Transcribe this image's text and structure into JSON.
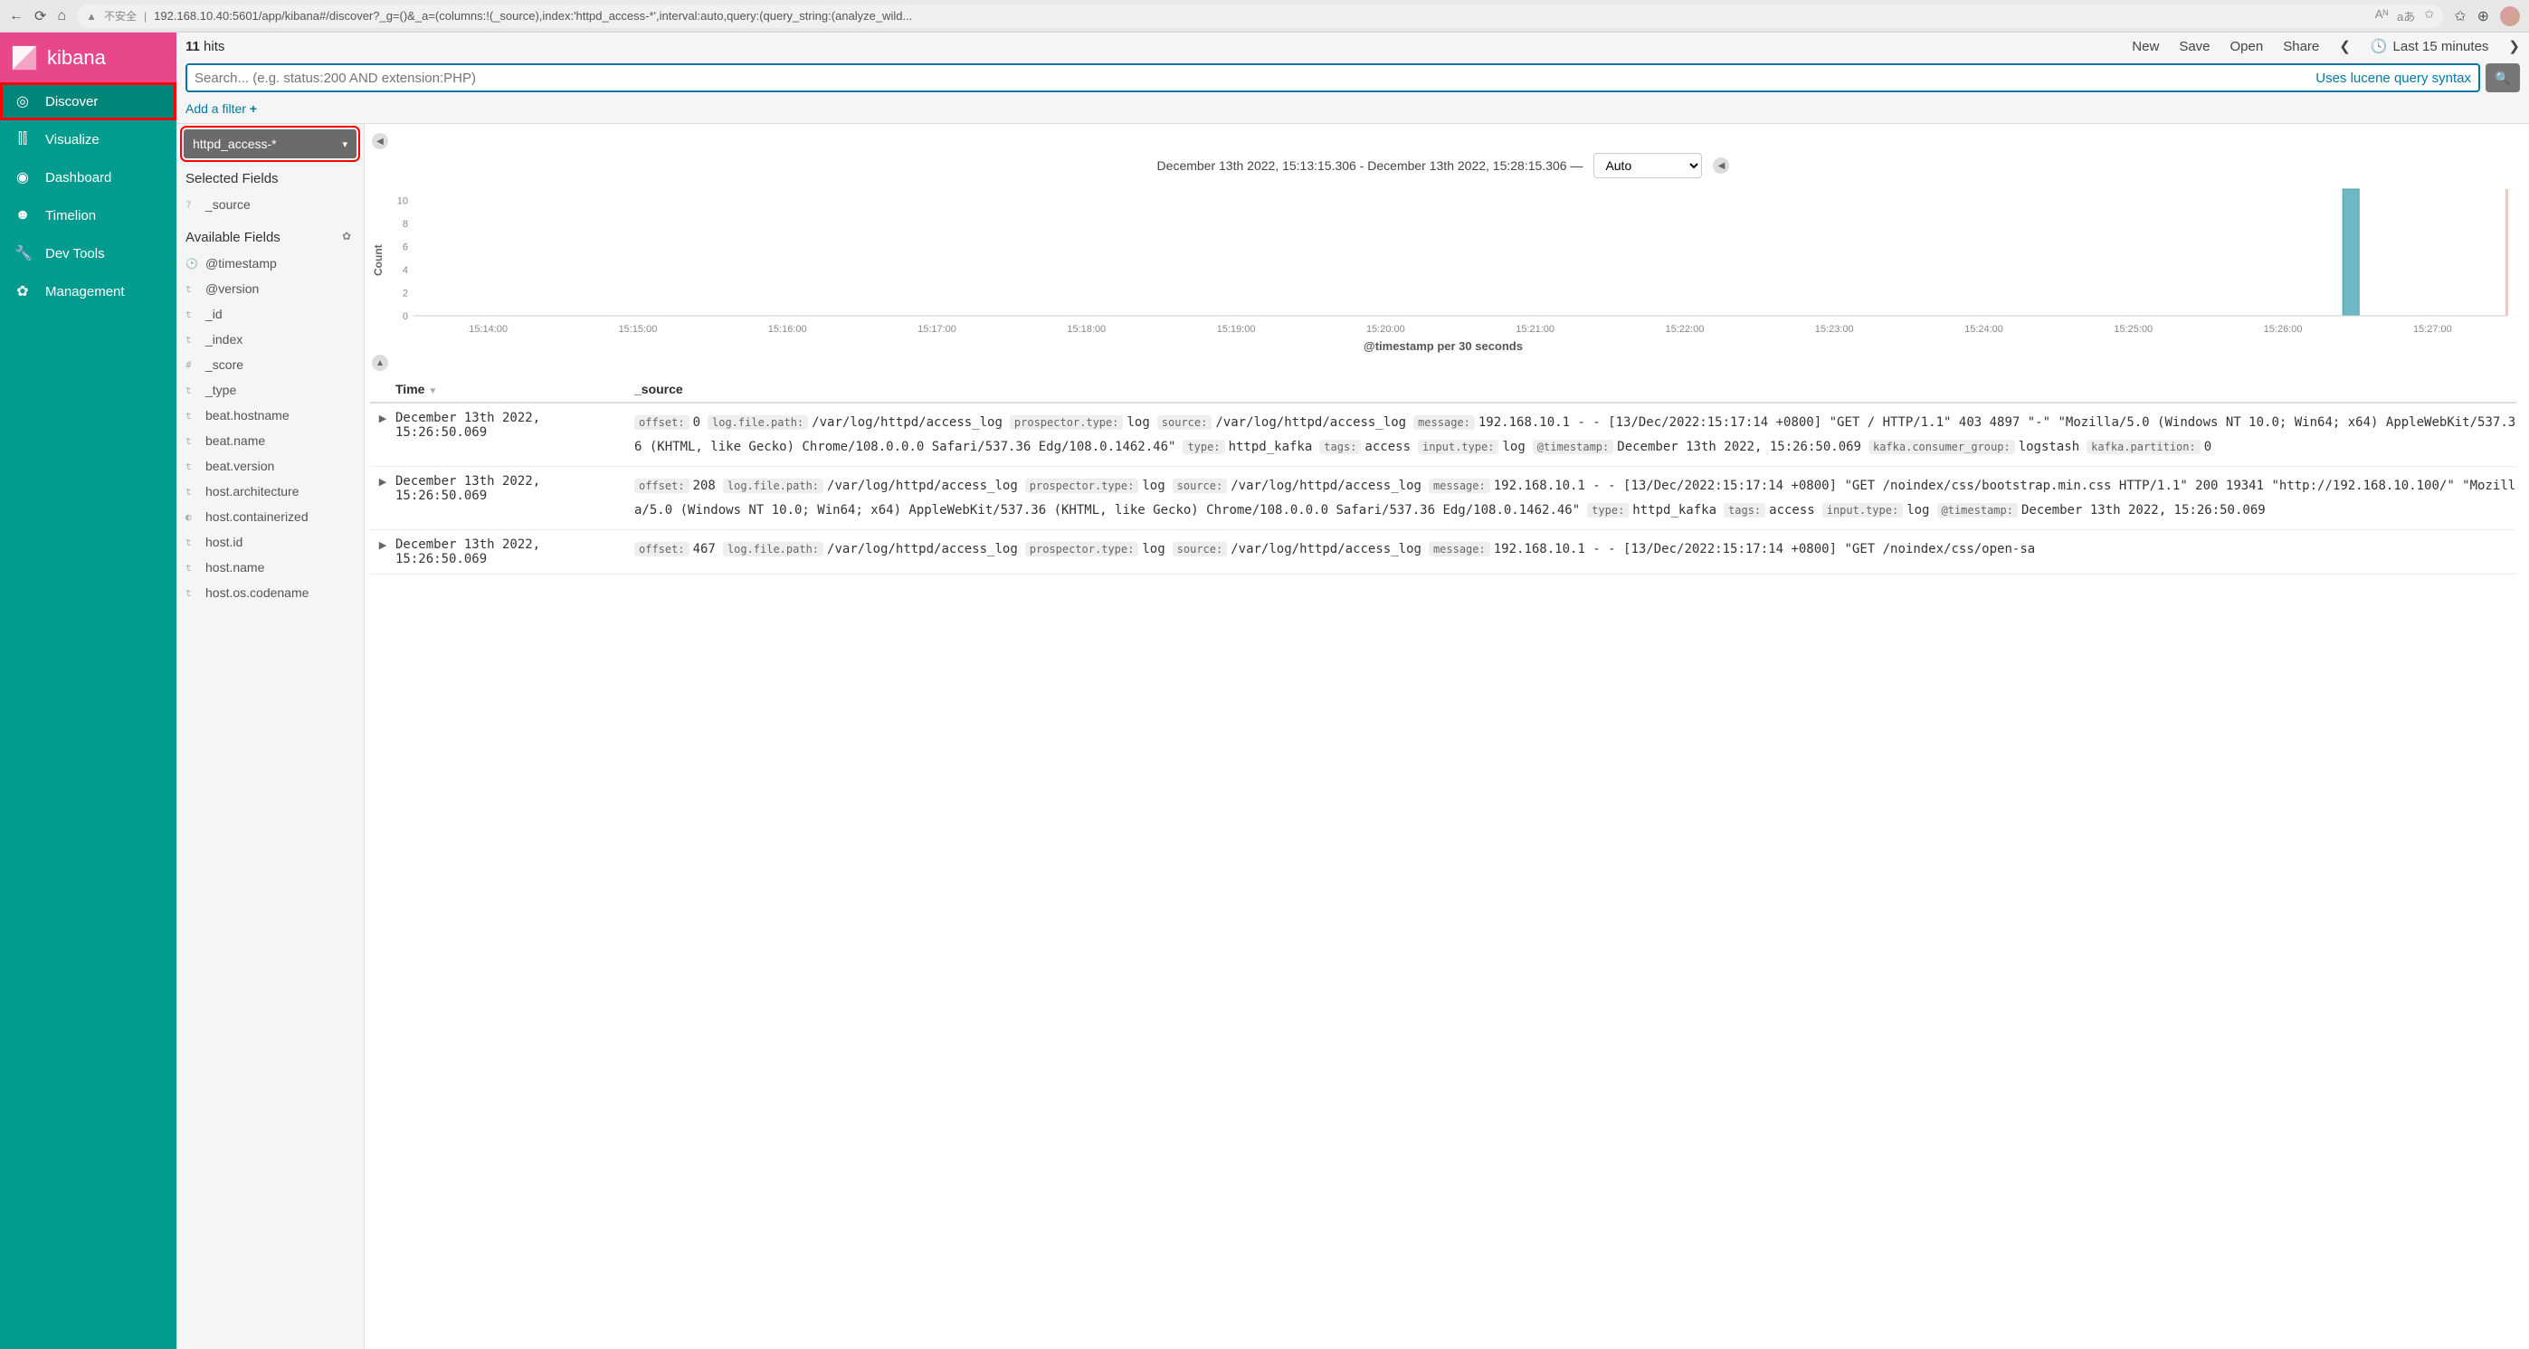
{
  "browser": {
    "insecure_label": "不安全",
    "url": "192.168.10.40:5601/app/kibana#/discover?_g=()&_a=(columns:!(_source),index:'httpd_access-*',interval:auto,query:(query_string:(analyze_wild..."
  },
  "brand": "kibana",
  "nav": [
    {
      "icon": "◎",
      "label": "Discover",
      "active": true,
      "highlight": true
    },
    {
      "icon": "⫿⫿",
      "label": "Visualize"
    },
    {
      "icon": "◉",
      "label": "Dashboard"
    },
    {
      "icon": "☻",
      "label": "Timelion"
    },
    {
      "icon": "🔧",
      "label": "Dev Tools"
    },
    {
      "icon": "✿",
      "label": "Management"
    }
  ],
  "topbar": {
    "hit_count": "11",
    "hit_label": "hits",
    "actions": [
      "New",
      "Save",
      "Open",
      "Share"
    ],
    "time_label": "Last 15 minutes"
  },
  "search": {
    "placeholder": "Search... (e.g. status:200 AND extension:PHP)",
    "lucene": "Uses lucene query syntax"
  },
  "filter_add": "Add a filter",
  "index_pattern": "httpd_access-*",
  "fields": {
    "selected_title": "Selected Fields",
    "selected": [
      {
        "t": "?",
        "name": "_source"
      }
    ],
    "available_title": "Available Fields",
    "available": [
      {
        "t": "🕑",
        "name": "@timestamp"
      },
      {
        "t": "t",
        "name": "@version"
      },
      {
        "t": "t",
        "name": "_id"
      },
      {
        "t": "t",
        "name": "_index"
      },
      {
        "t": "#",
        "name": "_score"
      },
      {
        "t": "t",
        "name": "_type"
      },
      {
        "t": "t",
        "name": "beat.hostname"
      },
      {
        "t": "t",
        "name": "beat.name"
      },
      {
        "t": "t",
        "name": "beat.version"
      },
      {
        "t": "t",
        "name": "host.architecture"
      },
      {
        "t": "◐",
        "name": "host.containerized"
      },
      {
        "t": "t",
        "name": "host.id"
      },
      {
        "t": "t",
        "name": "host.name"
      },
      {
        "t": "t",
        "name": "host.os.codename"
      }
    ]
  },
  "date_range": "December 13th 2022, 15:13:15.306 - December 13th 2022, 15:28:15.306 —",
  "interval": "Auto",
  "chart_data": {
    "type": "bar",
    "ylabel": "Count",
    "xlabel": "@timestamp per 30 seconds",
    "y_ticks": [
      0,
      2,
      4,
      6,
      8,
      10
    ],
    "x_ticks": [
      "15:14:00",
      "15:15:00",
      "15:16:00",
      "15:17:00",
      "15:18:00",
      "15:19:00",
      "15:20:00",
      "15:21:00",
      "15:22:00",
      "15:23:00",
      "15:24:00",
      "15:25:00",
      "15:26:00",
      "15:27:00"
    ],
    "series": [
      {
        "name": "Count",
        "color": "#6db7c6",
        "bars": [
          {
            "x_label": "15:26:30",
            "value": 11
          }
        ]
      }
    ],
    "ylim": [
      0,
      11
    ]
  },
  "table": {
    "headers": {
      "time": "Time",
      "source": "_source"
    },
    "rows": [
      {
        "time": "December 13th 2022, 15:26:50.069",
        "pairs": [
          {
            "k": "offset:",
            "v": "0"
          },
          {
            "k": "log.file.path:",
            "v": "/var/log/httpd/access_log"
          },
          {
            "k": "prospector.type:",
            "v": "log"
          },
          {
            "k": "source:",
            "v": "/var/log/httpd/access_log"
          },
          {
            "k": "message:",
            "v": "192.168.10.1 - - [13/Dec/2022:15:17:14 +0800] \"GET / HTTP/1.1\" 403 4897 \"-\" \"Mozilla/5.0 (Windows NT 10.0; Win64; x64) AppleWebKit/537.36 (KHTML, like Gecko) Chrome/108.0.0.0 Safari/537.36 Edg/108.0.1462.46\""
          },
          {
            "k": "type:",
            "v": "httpd_kafka"
          },
          {
            "k": "tags:",
            "v": "access"
          },
          {
            "k": "input.type:",
            "v": "log"
          },
          {
            "k": "@timestamp:",
            "v": "December 13th 2022, 15:26:50.069"
          },
          {
            "k": "kafka.consumer_group:",
            "v": "logstash"
          },
          {
            "k": "kafka.partition:",
            "v": "0"
          }
        ]
      },
      {
        "time": "December 13th 2022, 15:26:50.069",
        "pairs": [
          {
            "k": "offset:",
            "v": "208"
          },
          {
            "k": "log.file.path:",
            "v": "/var/log/httpd/access_log"
          },
          {
            "k": "prospector.type:",
            "v": "log"
          },
          {
            "k": "source:",
            "v": "/var/log/httpd/access_log"
          },
          {
            "k": "message:",
            "v": "192.168.10.1 - - [13/Dec/2022:15:17:14 +0800] \"GET /noindex/css/bootstrap.min.css HTTP/1.1\" 200 19341 \"http://192.168.10.100/\" \"Mozilla/5.0 (Windows NT 10.0; Win64; x64) AppleWebKit/537.36 (KHTML, like Gecko) Chrome/108.0.0.0 Safari/537.36 Edg/108.0.1462.46\""
          },
          {
            "k": "type:",
            "v": "httpd_kafka"
          },
          {
            "k": "tags:",
            "v": "access"
          },
          {
            "k": "input.type:",
            "v": "log"
          },
          {
            "k": "@timestamp:",
            "v": "December 13th 2022, 15:26:50.069"
          }
        ]
      },
      {
        "time": "December 13th 2022, 15:26:50.069",
        "pairs": [
          {
            "k": "offset:",
            "v": "467"
          },
          {
            "k": "log.file.path:",
            "v": "/var/log/httpd/access_log"
          },
          {
            "k": "prospector.type:",
            "v": "log"
          },
          {
            "k": "source:",
            "v": "/var/log/httpd/access_log"
          },
          {
            "k": "message:",
            "v": "192.168.10.1 - - [13/Dec/2022:15:17:14 +0800] \"GET /noindex/css/open-sa"
          }
        ]
      }
    ]
  }
}
